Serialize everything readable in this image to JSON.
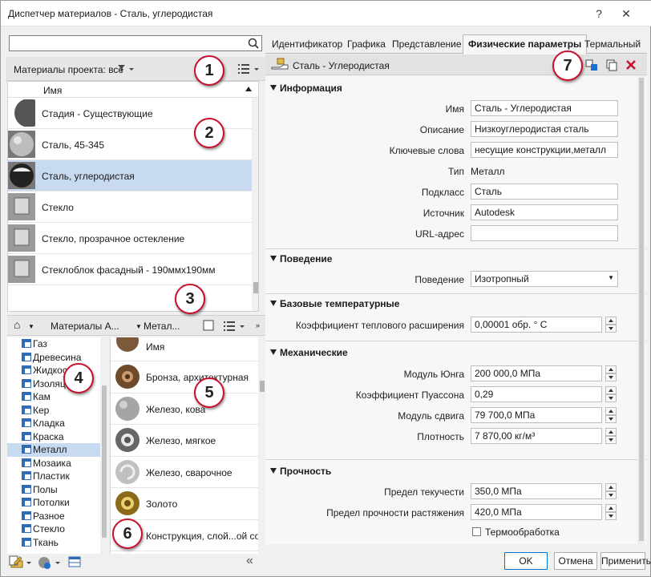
{
  "window": {
    "title": "Диспетчер материалов - Сталь, углеродистая",
    "help": "?",
    "close": "✕"
  },
  "search": {
    "placeholder": "",
    "value": ""
  },
  "project": {
    "label": "Материалы проекта: все"
  },
  "list1": {
    "header": "Имя",
    "items": [
      {
        "label": "Стадия - Существующие",
        "thumb": "dark-sphere"
      },
      {
        "label": "Сталь, 45-345",
        "thumb": "grey-sphere"
      },
      {
        "label": "Сталь, углеродистая",
        "thumb": "black-sphere",
        "selected": true
      },
      {
        "label": "Стекло",
        "thumb": "glass-cube"
      },
      {
        "label": "Стекло, прозрачное остекление",
        "thumb": "glass-cube"
      },
      {
        "label": "Стеклоблок фасадный - 190ммх190мм",
        "thumb": "glass-cube"
      }
    ]
  },
  "breadcrumb": {
    "home": "⌂",
    "part1": "Материалы А...",
    "part2": "Метал..."
  },
  "tree": {
    "items": [
      {
        "label": "Газ"
      },
      {
        "label": "Древесина"
      },
      {
        "label": "Жидкость"
      },
      {
        "label": "Изоляция"
      },
      {
        "label": "Кам"
      },
      {
        "label": "Кер"
      },
      {
        "label": "Кладка"
      },
      {
        "label": "Краска"
      },
      {
        "label": "Металл",
        "selected": true
      },
      {
        "label": "Мозаика"
      },
      {
        "label": "Пластик"
      },
      {
        "label": "Полы"
      },
      {
        "label": "Потолки"
      },
      {
        "label": "Разное"
      },
      {
        "label": "Стекло"
      },
      {
        "label": "Ткань"
      }
    ]
  },
  "list2": {
    "header": "Имя",
    "items": [
      {
        "label": "Бронза, архитектурная",
        "thumb": "bronze"
      },
      {
        "label": "Железо, кова",
        "thumb": "iron"
      },
      {
        "label": "Железо, мягкое",
        "thumb": "iron-ring"
      },
      {
        "label": "Железо, сварочное",
        "thumb": "iron-swirl"
      },
      {
        "label": "Золото",
        "thumb": "gold"
      },
      {
        "label": "Конструкция, слой...ой сор",
        "thumb": "grey"
      }
    ]
  },
  "tabs": [
    "Идентификатор",
    "Графика",
    "Представление",
    "Физические параметры",
    "Термальный"
  ],
  "material_header": {
    "name": "Сталь - Углеродистая"
  },
  "sections": {
    "info": "Информация",
    "behavior": "Поведение",
    "temps": "Базовые температурные",
    "mech": "Механические",
    "strength": "Прочность"
  },
  "info": {
    "name_label": "Имя",
    "name_value": "Сталь - Углеродистая",
    "desc_label": "Описание",
    "desc_value": "Низкоуглеродистая сталь",
    "keys_label": "Ключевые слова",
    "keys_value": "несущие конструкции,металл",
    "type_label": "Тип",
    "type_value": "Металл",
    "subclass_label": "Подкласс",
    "subclass_value": "Сталь",
    "source_label": "Источник",
    "source_value": "Autodesk",
    "url_label": "URL-адрес",
    "url_value": ""
  },
  "behavior": {
    "label": "Поведение",
    "value": "Изотропный"
  },
  "temps": {
    "label": "Коэффициент теплового расширения",
    "value": "0,00001 обр. ° C"
  },
  "mech": {
    "young_label": "Модуль Юнга",
    "young_value": "200 000,0 МПа",
    "poisson_label": "Коэффициент Пуассона",
    "poisson_value": "0,29",
    "shear_label": "Модуль сдвига",
    "shear_value": "79 700,0 МПа",
    "density_label": "Плотность",
    "density_value": "7 870,00 кг/м³"
  },
  "strength": {
    "yield_label": "Предел текучести",
    "yield_value": "350,0 МПа",
    "tensile_label": "Предел прочности растяжения",
    "tensile_value": "420,0 МПа",
    "heat_label": "Термообработка",
    "heat_checked": false
  },
  "buttons": {
    "ok": "OK",
    "cancel": "Отмена",
    "apply": "Применить"
  },
  "callouts": [
    "1",
    "2",
    "3",
    "4",
    "5",
    "6",
    "7"
  ],
  "colors": {
    "selection": "#c8daef",
    "callout_border": "#c8102e",
    "accent": "#0078d7",
    "delete": "#c8102e"
  }
}
